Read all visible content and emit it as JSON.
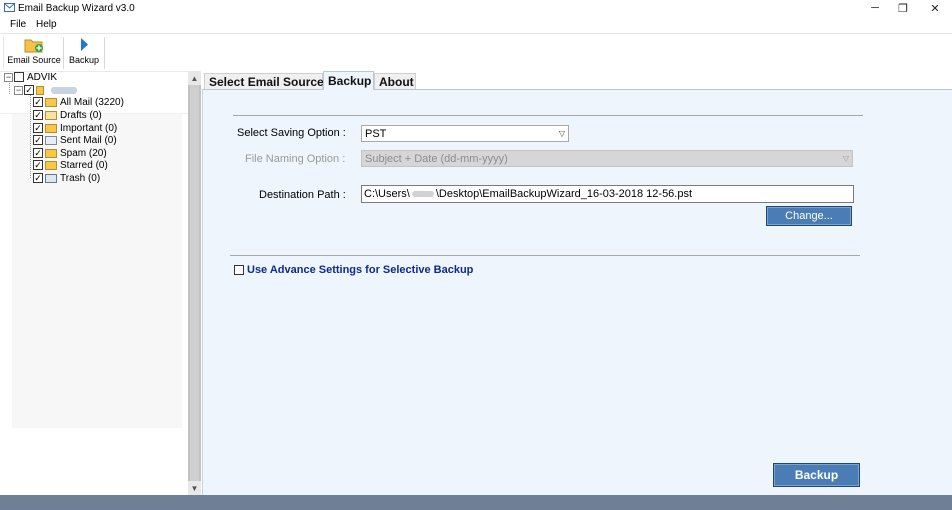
{
  "window": {
    "title": "Email Backup Wizard v3.0",
    "controls": {
      "minimize": "─",
      "maximize": "❐",
      "close": "✕"
    }
  },
  "menubar": {
    "items": [
      "File",
      "Help"
    ]
  },
  "toolbar": {
    "email_source_label": "Email Source",
    "backup_label": "Backup"
  },
  "tree": {
    "root_label": "ADVIK",
    "folders": [
      {
        "label": "All Mail (3220)",
        "icon": "folder-icon"
      },
      {
        "label": "Drafts (0)",
        "icon": "drafts-icon"
      },
      {
        "label": "Important (0)",
        "icon": "folder-icon"
      },
      {
        "label": "Sent Mail (0)",
        "icon": "sent-icon"
      },
      {
        "label": "Spam (20)",
        "icon": "folder-icon"
      },
      {
        "label": "Starred (0)",
        "icon": "folder-icon"
      },
      {
        "label": "Trash (0)",
        "icon": "trash-icon"
      }
    ]
  },
  "tabs": [
    "Select Email Source",
    "Backup",
    "About"
  ],
  "backup": {
    "saving_option_label": "Select Saving Option  :",
    "saving_option_value": "PST",
    "file_naming_label": "File Naming Option  :",
    "file_naming_value": "Subject + Date (dd-mm-yyyy)",
    "destination_label": "Destination Path  :",
    "destination_prefix": "C:\\Users\\",
    "destination_suffix": "\\Desktop\\EmailBackupWizard_16-03-2018 12-56.pst",
    "change_button": "Change...",
    "advance_settings_label": "Use Advance Settings for Selective Backup",
    "backup_button": "Backup"
  },
  "colors": {
    "panel_bg": "#eef5fd",
    "button_bg": "#4a7db6",
    "advance_label": "#0d2a8f",
    "status_bar": "#6f7f96"
  }
}
